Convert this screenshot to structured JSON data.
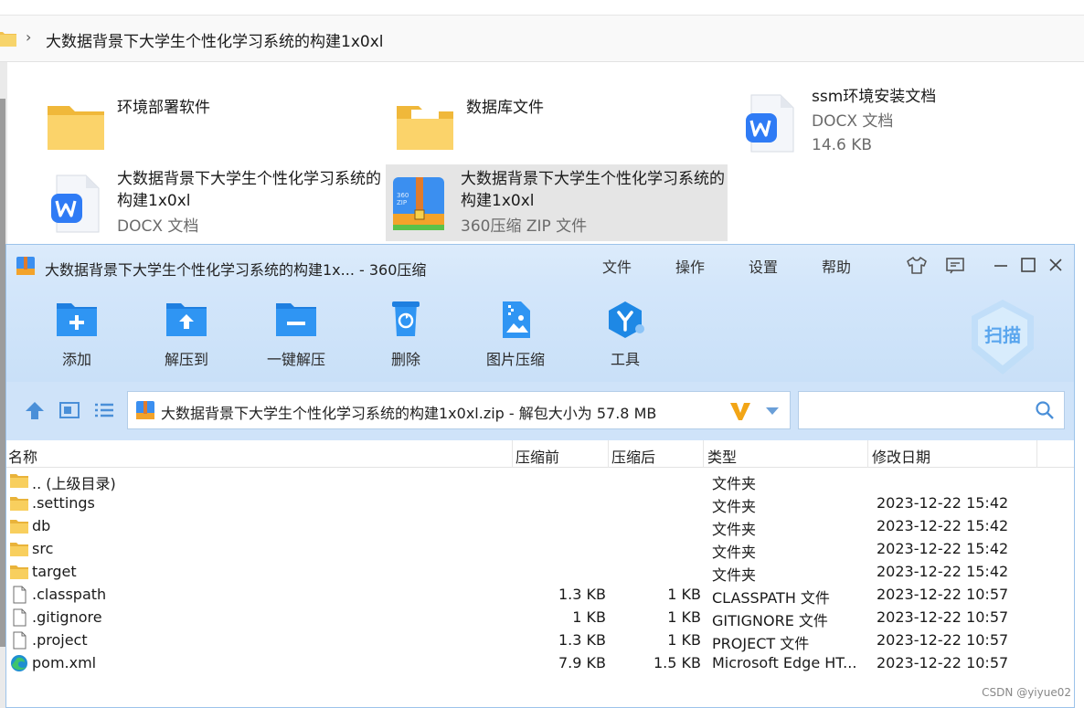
{
  "explorer": {
    "breadcrumb": "大数据背景下大学生个性化学习系统的构建1x0xl",
    "items": [
      {
        "name": "环境部署软件",
        "line2": "",
        "line3": "",
        "kind": "folder"
      },
      {
        "name": "数据库文件",
        "line2": "",
        "line3": "",
        "kind": "folder-doc"
      },
      {
        "name": "ssm环境安装文档",
        "line2": "DOCX 文档",
        "line3": "14.6 KB",
        "kind": "docx"
      },
      {
        "name": "大数据背景下大学生个性化学习系统的构建1x0xl",
        "line2": "DOCX 文档",
        "line3": "",
        "kind": "docx"
      },
      {
        "name": "大数据背景下大学生个性化学习系统的构建1x0xl",
        "line2": "360压缩 ZIP 文件",
        "line3": "",
        "kind": "zip"
      }
    ]
  },
  "window": {
    "title": "大数据背景下大学生个性化学习系统的构建1x... - 360压缩",
    "menu": [
      "文件",
      "操作",
      "设置",
      "帮助"
    ],
    "toolbar": [
      "添加",
      "解压到",
      "一键解压",
      "删除",
      "图片压缩",
      "工具"
    ],
    "scan_label": "扫描",
    "path_text": "大数据背景下大学生个性化学习系统的构建1x0xl.zip - 解包大小为 57.8 MB",
    "search_placeholder": "",
    "columns": {
      "name": "名称",
      "packed": "压缩前",
      "compressed": "压缩后",
      "type": "类型",
      "modified": "修改日期"
    },
    "rows": [
      {
        "name": ".. (上级目录)",
        "packed": "",
        "compressed": "",
        "type": "文件夹",
        "modified": "",
        "icon": "folder"
      },
      {
        "name": ".settings",
        "packed": "",
        "compressed": "",
        "type": "文件夹",
        "modified": "2023-12-22 15:42",
        "icon": "folder"
      },
      {
        "name": "db",
        "packed": "",
        "compressed": "",
        "type": "文件夹",
        "modified": "2023-12-22 15:42",
        "icon": "folder"
      },
      {
        "name": "src",
        "packed": "",
        "compressed": "",
        "type": "文件夹",
        "modified": "2023-12-22 15:42",
        "icon": "folder"
      },
      {
        "name": "target",
        "packed": "",
        "compressed": "",
        "type": "文件夹",
        "modified": "2023-12-22 15:42",
        "icon": "folder"
      },
      {
        "name": ".classpath",
        "packed": "1.3 KB",
        "compressed": "1 KB",
        "type": "CLASSPATH 文件",
        "modified": "2023-12-22 10:57",
        "icon": "file"
      },
      {
        "name": ".gitignore",
        "packed": "1 KB",
        "compressed": "1 KB",
        "type": "GITIGNORE 文件",
        "modified": "2023-12-22 10:57",
        "icon": "file"
      },
      {
        "name": ".project",
        "packed": "1.3 KB",
        "compressed": "1 KB",
        "type": "PROJECT 文件",
        "modified": "2023-12-22 10:57",
        "icon": "file"
      },
      {
        "name": "pom.xml",
        "packed": "7.9 KB",
        "compressed": "1.5 KB",
        "type": "Microsoft Edge HT...",
        "modified": "2023-12-22 10:57",
        "icon": "edge"
      }
    ]
  },
  "watermark": "CSDN @yiyue02",
  "colors": {
    "accent": "#1e88e5",
    "titlebar": "#d8e9fb",
    "folder": "#f5c842"
  }
}
